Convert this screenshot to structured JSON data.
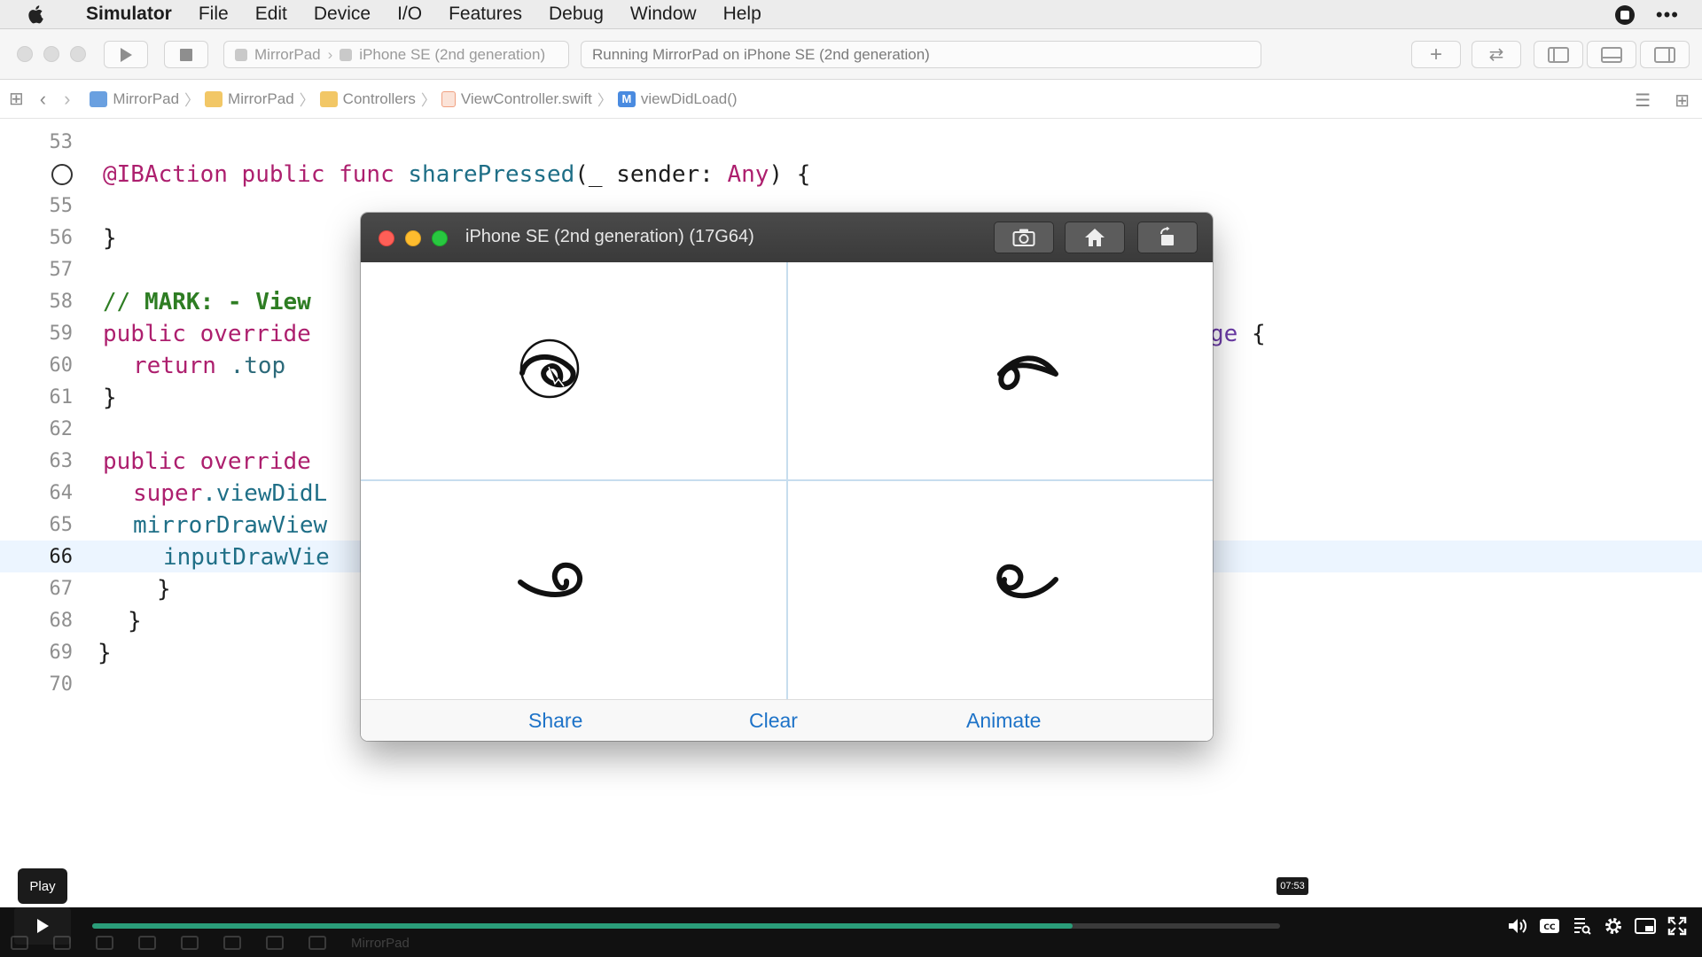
{
  "menubar": {
    "apple_icon": "apple-logo-icon",
    "app_name": "Simulator",
    "items": [
      "File",
      "Edit",
      "Device",
      "I/O",
      "Features",
      "Debug",
      "Window",
      "Help"
    ]
  },
  "toolbar": {
    "scheme_project": "MirrorPad",
    "scheme_device": "iPhone SE (2nd generation)",
    "status_text": "Running MirrorPad on iPhone SE (2nd generation)"
  },
  "jumpbar": {
    "crumbs": [
      "MirrorPad",
      "MirrorPad",
      "Controllers",
      "ViewController.swift",
      "viewDidLoad()"
    ],
    "method_badge": "M"
  },
  "editor": {
    "current_line": "66",
    "lines": [
      {
        "num": "53"
      },
      {
        "num": "",
        "tokens": [
          "@IBAction",
          "public",
          "func",
          "sharePressed",
          "(_ sender: ",
          "Any",
          ") {"
        ]
      },
      {
        "num": "55"
      },
      {
        "num": "56",
        "text": "}"
      },
      {
        "num": "57"
      },
      {
        "num": "58",
        "comment": "// ",
        "mark": "MARK: - View"
      },
      {
        "num": "59",
        "kw": "public override",
        "tail_hidden": "ge",
        "tail": " {"
      },
      {
        "num": "60",
        "kw": "return",
        "rest": " .top"
      },
      {
        "num": "61",
        "text": "}"
      },
      {
        "num": "62"
      },
      {
        "num": "63",
        "kw": "public override"
      },
      {
        "num": "64",
        "kw": "super",
        "rest": ".viewDidL"
      },
      {
        "num": "65",
        "prop": "mirrorDrawView"
      },
      {
        "num": "66",
        "prop": "inputDrawVie"
      },
      {
        "num": "67",
        "text": "}"
      },
      {
        "num": "68",
        "text": "}"
      },
      {
        "num": "69",
        "text": "}"
      },
      {
        "num": "70"
      }
    ]
  },
  "simulator": {
    "title": "iPhone SE (2nd generation) (17G64)",
    "buttons": {
      "screenshot": "camera-icon",
      "home": "home-icon",
      "rotate": "rotate-icon"
    },
    "actions": {
      "share": "Share",
      "clear": "Clear",
      "animate": "Animate"
    }
  },
  "player": {
    "tooltip": "Play",
    "timestamp": "07:53",
    "progress_fraction": 0.825,
    "dock_label": "MirrorPad"
  },
  "colors": {
    "keyword": "#ad1f6e",
    "function": "#1f6f87",
    "comment": "#2e7d23",
    "ios_tint": "#1e73c8",
    "progress": "#2a9d79"
  }
}
